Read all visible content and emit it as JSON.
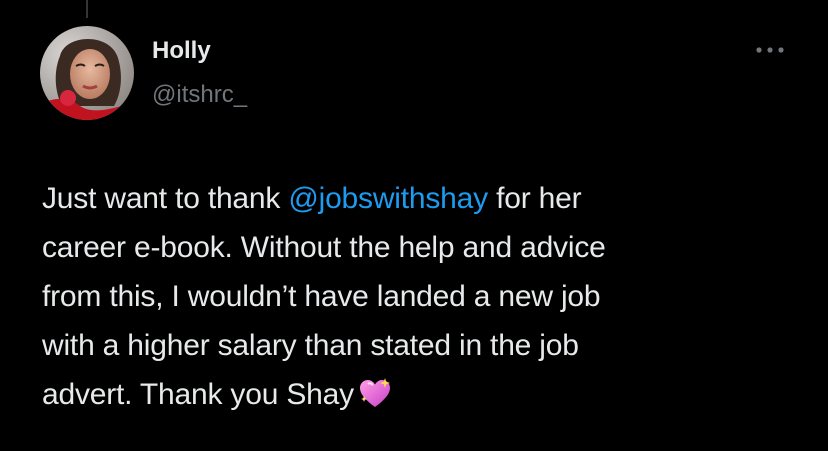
{
  "tweet": {
    "author": {
      "display_name": "Holly",
      "handle": "@itshrc_"
    },
    "more_icon": "more-horizontal-icon",
    "text_lines": [
      {
        "before": "Just want to thank ",
        "mention": "@jobswithshay",
        "after": " for her"
      },
      "career e-book. Without the help and advice",
      "from this, I wouldn’t have landed a new job",
      "with a higher salary than stated in the job",
      "advert. Thank you Shay"
    ],
    "emoji": "sparkling-heart-emoji"
  },
  "colors": {
    "background": "#000000",
    "text": "#e7e9ea",
    "secondary_text": "#71767b",
    "accent": "#1d9bf0",
    "thread_line": "#333639"
  }
}
